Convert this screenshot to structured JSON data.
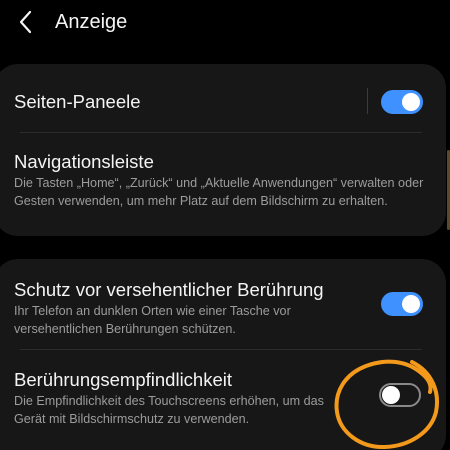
{
  "header": {
    "title": "Anzeige"
  },
  "sections": [
    {
      "rows": [
        {
          "title": "Seiten-Paneele",
          "toggle": true
        },
        {
          "title": "Navigationsleiste",
          "description": "Die Tasten „Home“, „Zurück“ und „Aktuelle Anwendungen“ verwalten oder Gesten verwenden, um mehr Platz auf dem Bildschirm zu erhalten."
        }
      ]
    },
    {
      "rows": [
        {
          "title": "Schutz vor versehentlicher Berührung",
          "description": "Ihr Telefon an dunklen Orten wie einer Tasche vor versehentlichen Berührungen schützen.",
          "toggle": true
        },
        {
          "title": "Berührungsempfindlichkeit",
          "description": "Die Empfindlichkeit des Touchscreens erhöhen, um das Gerät mit Bildschirmschutz zu verwenden.",
          "toggle": false
        }
      ]
    }
  ],
  "colors": {
    "background": "#000000",
    "card": "#171717",
    "toggle_on": "#3e91ff",
    "toggle_off_border": "#8a8a8a",
    "annotation": "#f39a1c"
  },
  "icons": {
    "back": "chevron-left-icon"
  }
}
